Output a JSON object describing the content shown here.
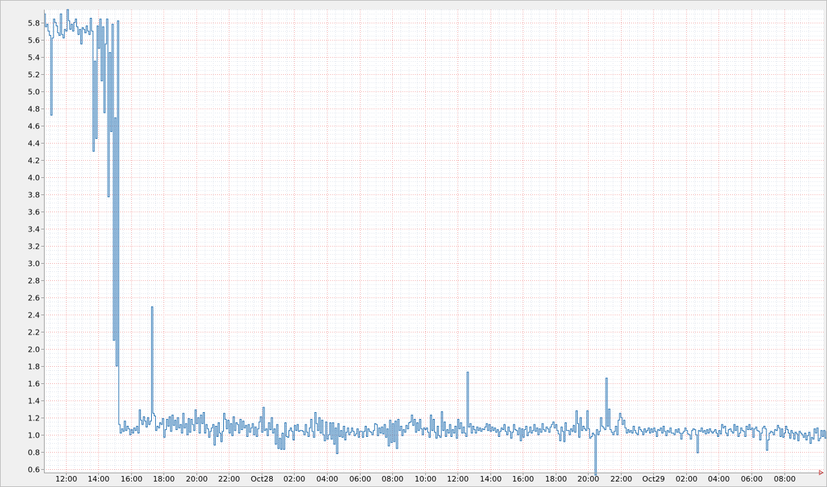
{
  "chart_data": {
    "type": "line",
    "title": "",
    "xlabel": "",
    "ylabel": "",
    "grid": true,
    "x_tick_labels": [
      "12:00",
      "14:00",
      "16:00",
      "18:00",
      "20:00",
      "22:00",
      "Oct28",
      "02:00",
      "04:00",
      "06:00",
      "08:00",
      "10:00",
      "12:00",
      "14:00",
      "16:00",
      "18:00",
      "20:00",
      "22:00",
      "Oct29",
      "02:00",
      "04:00",
      "06:00",
      "08:00"
    ],
    "x_range": [
      "Oct27 10:40",
      "Oct29 10:25"
    ],
    "y_ticks": [
      "0.6",
      "0.8",
      "1.0",
      "1.2",
      "1.4",
      "1.6",
      "1.8",
      "2.0",
      "2.2",
      "2.4",
      "2.6",
      "2.8",
      "3.0",
      "3.2",
      "3.4",
      "3.6",
      "3.8",
      "4.0",
      "4.2",
      "4.4",
      "4.6",
      "4.8",
      "5.0",
      "5.2",
      "5.4",
      "5.6",
      "5.8"
    ],
    "ylim": [
      0.56,
      5.95
    ],
    "line_color": "#1f6eb0",
    "series": [
      {
        "step": true,
        "start": "Oct27 10:40",
        "interval_minutes": 5,
        "values": [
          5.9,
          5.75,
          5.78,
          5.7,
          5.65,
          4.72,
          5.62,
          5.84,
          5.8,
          5.76,
          5.68,
          5.65,
          5.9,
          5.66,
          5.62,
          5.72,
          5.7,
          5.95,
          5.82,
          5.72,
          5.78,
          5.7,
          5.8,
          5.84,
          5.75,
          5.66,
          5.72,
          5.55,
          5.74,
          5.72,
          5.68,
          5.76,
          5.7,
          5.66,
          5.85,
          5.7,
          4.3,
          5.35,
          4.45,
          5.76,
          5.5,
          5.84,
          5.12,
          5.75,
          4.75,
          5.55,
          5.84,
          3.77,
          5.45,
          4.53,
          5.78,
          2.1,
          4.69,
          1.8,
          5.82,
          1.12,
          1.02,
          1.07,
          1.04,
          1.16,
          1.05,
          1.1,
          1.07,
          1.0,
          1.06,
          1.02,
          1.08,
          1.05,
          1.1,
          1.02,
          1.29,
          1.17,
          1.12,
          1.21,
          1.16,
          1.09,
          1.2,
          1.12,
          1.16,
          2.49,
          1.25,
          1.22,
          1.05,
          1.1,
          1.08,
          1.14,
          1.12,
          1.19,
          0.97,
          1.06,
          1.18,
          1.1,
          1.21,
          1.04,
          1.23,
          1.11,
          1.17,
          1.06,
          1.2,
          1.08,
          1.12,
          1.02,
          1.25,
          1.08,
          1.13,
          1.0,
          1.19,
          1.03,
          1.18,
          1.12,
          1.05,
          1.29,
          1.13,
          1.2,
          1.02,
          1.23,
          1.13,
          1.26,
          1.02,
          1.12,
          1.07,
          0.97,
          1.04,
          1.08,
          1.12,
          0.88,
          1.1,
          0.98,
          1.14,
          1.02,
          0.92,
          1.04,
          1.25,
          1.18,
          1.07,
          1.17,
          1.02,
          1.13,
          0.99,
          1.21,
          1.05,
          1.14,
          1.12,
          1.02,
          1.18,
          1.06,
          1.16,
          1.08,
          1.11,
          0.98,
          1.12,
          1.03,
          1.08,
          1.13,
          1.0,
          1.09,
          0.98,
          1.07,
          1.15,
          1.21,
          1.03,
          1.32,
          1.05,
          1.07,
          0.99,
          1.14,
          1.06,
          1.2,
          1.02,
          1.07,
          0.89,
          1.12,
          0.84,
          0.96,
          0.83,
          1.02,
          0.83,
          1.14,
          0.98,
          0.97,
          1.05,
          1.08,
          1.04,
          0.94,
          1.11,
          1.05,
          1.12,
          1.04,
          1.05,
          1.05,
          1.04,
          1.0,
          1.12,
          1.03,
          0.98,
          1.08,
          1.18,
          1.04,
          0.97,
          1.26,
          1.13,
          1.05,
          1.2,
          1.02,
          1.17,
          1.0,
          0.93,
          1.15,
          0.95,
          1.0,
          1.14,
          0.95,
          1.14,
          0.89,
          1.08,
          0.78,
          1.13,
          0.98,
          1.05,
          0.97,
          1.1,
          0.94,
          1.03,
          1.08,
          1.0,
          1.03,
          1.08,
          1.04,
          0.99,
          1.01,
          1.07,
          0.97,
          1.04,
          1.04,
          0.97,
          1.04,
          1.1,
          0.98,
          1.07,
          1.04,
          1.03,
          1.0,
          1.05,
          1.13,
          1.12,
          0.99,
          1.08,
          1.02,
          1.09,
          1.01,
          1.12,
          0.97,
          1.07,
          0.87,
          1.17,
          0.91,
          1.13,
          0.92,
          1.16,
          0.84,
          1.18,
          1.05,
          1.1,
          0.99,
          1.06,
          1.03,
          1.11,
          1.07,
          1.14,
          1.15,
          1.23,
          1.11,
          1.18,
          1.03,
          1.14,
          1.05,
          1.18,
          1.07,
          1.0,
          1.08,
          1.06,
          1.08,
          1.03,
          0.97,
          1.23,
          1.05,
          1.18,
          1.03,
          0.96,
          1.1,
          0.99,
          0.97,
          1.27,
          1.05,
          1.15,
          0.98,
          1.06,
          1.02,
          1.12,
          0.98,
          1.06,
          1.02,
          1.1,
          0.96,
          1.18,
          1.07,
          1.14,
          1.02,
          1.09,
          1.02,
          0.98,
          1.73,
          1.09,
          1.13,
          1.02,
          1.1,
          1.06,
          1.02,
          1.09,
          1.05,
          1.08,
          1.04,
          1.07,
          1.06,
          1.09,
          1.13,
          1.05,
          1.12,
          1.04,
          1.09,
          1.05,
          1.08,
          1.03,
          1.06,
          0.98,
          1.04,
          1.08,
          1.06,
          1.12,
          1.04,
          1.0,
          1.09,
          1.04,
          0.96,
          1.03,
          1.12,
          1.06,
          1.05,
          1.0,
          1.08,
          0.93,
          1.07,
          0.97,
          1.06,
          1.1,
          0.99,
          1.03,
          1.09,
          1.02,
          1.05,
          1.12,
          1.04,
          1.08,
          1.0,
          1.07,
          1.03,
          1.13,
          1.06,
          1.04,
          1.09,
          1.07,
          1.03,
          1.09,
          1.12,
          1.15,
          1.08,
          1.12,
          1.05,
          1.01,
          0.93,
          1.09,
          1.04,
          0.92,
          1.14,
          1.05,
          1.05,
          1.0,
          1.07,
          1.04,
          1.11,
          1.03,
          1.28,
          1.13,
          0.97,
          1.2,
          1.05,
          1.1,
          1.07,
          1.05,
          1.28,
          1.07,
          0.96,
          0.98,
          1.02,
          1.0,
          0.53,
          1.06,
          1.0,
          1.04,
          1.2,
          1.1,
          1.08,
          1.06,
          1.66,
          1.1,
          1.3,
          1.06,
          1.03,
          1.0,
          1.04,
          1.1,
          1.0,
          1.17,
          1.25,
          1.2,
          1.12,
          1.17,
          1.08,
          1.02,
          1.06,
          1.03,
          1.05,
          1.02,
          1.1,
          1.05,
          1.02,
          1.0,
          1.09,
          1.06,
          1.04,
          1.0,
          1.07,
          1.03,
          1.05,
          1.08,
          1.02,
          1.07,
          1.03,
          1.08,
          1.04,
          0.98,
          1.06,
          1.05,
          1.08,
          1.02,
          1.1,
          1.04,
          0.99,
          1.05,
          1.03,
          1.08,
          1.02,
          1.02,
          1.0,
          1.06,
          1.03,
          1.07,
          1.02,
          0.95,
          1.02,
          1.04,
          1.08,
          1.05,
          1.01,
          1.0,
          0.95,
          1.05,
          1.07,
          1.06,
          1.0,
          0.79,
          1.05,
          1.04,
          1.08,
          1.03,
          1.05,
          1.01,
          1.06,
          1.02,
          1.07,
          1.04,
          1.02,
          1.04,
          1.06,
          1.02,
          0.98,
          1.05,
          1.01,
          1.12,
          1.08,
          1.1,
          1.02,
          0.99,
          1.06,
          1.07,
          1.04,
          1.02,
          1.12,
          1.05,
          1.1,
          0.98,
          1.02,
          1.08,
          1.05,
          1.04,
          0.98,
          1.1,
          1.06,
          1.12,
          1.06,
          1.08,
          0.97,
          1.07,
          1.09,
          1.05,
          1.04,
          0.94,
          1.02,
          1.08,
          1.1,
          1.07,
          0.82,
          0.94,
          1.02,
          1.04,
          1.03,
          1.0,
          1.06,
          1.05,
          1.11,
          1.08,
          0.98,
          1.07,
          0.97,
          1.02,
          1.1,
          1.06,
          1.02,
          0.96,
          1.05,
          1.02,
          0.95,
          1.03,
          1.01,
          0.93,
          1.04,
          1.02,
          1.0,
          0.97,
          1.02,
          0.94,
          0.99,
          1.03,
          0.9,
          0.97,
          0.95,
          1.07,
          1.02,
          1.08,
          0.93,
          0.96,
          1.05,
          0.98,
          1.05,
          0.96,
          1.04,
          0.98,
          1.03,
          0.96,
          1.1,
          1.05,
          1.13,
          0.98,
          1.05,
          1.06,
          1.02,
          0.91,
          1.09,
          0.96,
          1.05,
          1.02,
          0.95,
          1.07,
          0.98,
          1.03,
          0.94,
          1.04,
          0.97,
          1.05,
          0.91,
          1.0,
          1.02,
          0.96,
          0.93,
          1.08,
          1.03,
          0.95,
          0.99,
          1.02,
          0.92,
          1.06,
          0.97,
          1.05,
          0.91,
          1.0,
          0.95,
          1.0,
          0.85,
          1.03,
          0.97,
          0.98,
          0.96,
          1.01,
          1.02,
          0.95,
          0.94,
          1.13,
          1.05,
          1.02,
          1.07,
          0.95,
          1.0,
          1.06,
          1.04,
          0.98,
          1.07,
          0.96,
          1.02,
          1.0,
          0.97
        ]
      }
    ]
  }
}
